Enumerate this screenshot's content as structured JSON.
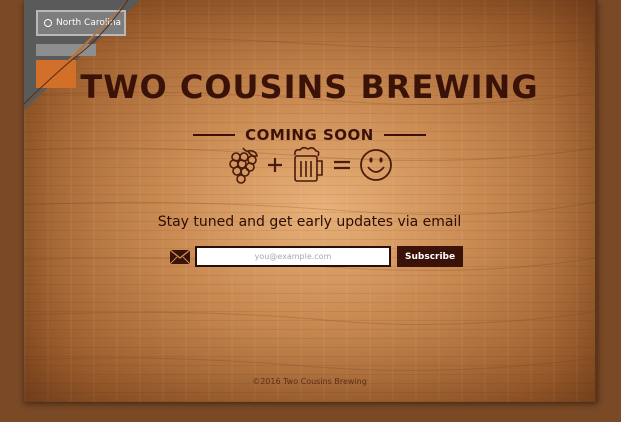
{
  "brand": {
    "title": "TWO COUSINS BREWING"
  },
  "hero": {
    "coming_soon": "COMING SOON",
    "equation": [
      "grapes-icon",
      "plus-icon",
      "beer-mug-icon",
      "equals-icon",
      "smiley-icon"
    ]
  },
  "signup": {
    "tagline": "Stay tuned and get early updates via email",
    "email_placeholder": "you@example.com",
    "subscribe_label": "Subscribe",
    "icon": "envelope-icon"
  },
  "footer": {
    "copyright": "©2016 Two Cousins Brewing"
  },
  "peel_corner": {
    "location_label": "North Carolina"
  },
  "colors": {
    "ink": "#3a1208",
    "wood": "#c98a52",
    "frame": "#7a4a26",
    "accent_orange": "#d2702a"
  }
}
